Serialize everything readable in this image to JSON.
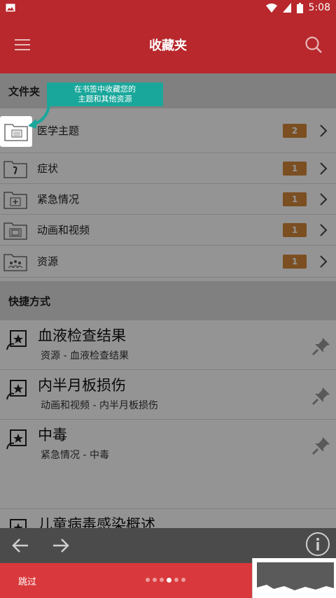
{
  "status_bar": {
    "time": "5:08",
    "icons": [
      "image-icon",
      "wifi-icon",
      "signal-icon",
      "battery-icon"
    ]
  },
  "app_bar": {
    "title": "收藏夹",
    "menu_icon": "hamburger-menu-icon",
    "search_icon": "search-icon"
  },
  "folders": {
    "header": "文件夹",
    "items": [
      {
        "label": "医学主题",
        "count": "2",
        "icon": "folder-document-icon"
      },
      {
        "label": "症状",
        "count": "1",
        "icon": "folder-symptom-icon"
      },
      {
        "label": "紧急情况",
        "count": "1",
        "icon": "folder-emergency-icon"
      },
      {
        "label": "动画和视频",
        "count": "1",
        "icon": "folder-video-icon"
      },
      {
        "label": "资源",
        "count": "1",
        "icon": "folder-resources-icon"
      }
    ]
  },
  "tooltip": {
    "line1": "在书签中收藏您的",
    "line2": "主题和其他资源"
  },
  "shortcuts": {
    "header": "快捷方式",
    "items": [
      {
        "title": "血液检查结果",
        "subtitle": "资源 - 血液检查结果"
      },
      {
        "title": "内半月板损伤",
        "subtitle": "动画和视频 - 内半月板损伤"
      },
      {
        "title": "中毒",
        "subtitle": "紧急情况 - 中毒"
      },
      {
        "title": "儿童病毒感染概述",
        "subtitle": ""
      }
    ]
  },
  "bottom_nav": {
    "back_icon": "arrow-left-icon",
    "forward_icon": "arrow-right-icon",
    "info_icon": "info-icon"
  },
  "onboarding": {
    "skip_label": "跳过",
    "total_pages": 6,
    "active_page": 4
  },
  "colors": {
    "primary": "#b8282c",
    "badge": "#d5893a",
    "tooltip": "#1aa79b",
    "onboard": "#d9393c"
  }
}
